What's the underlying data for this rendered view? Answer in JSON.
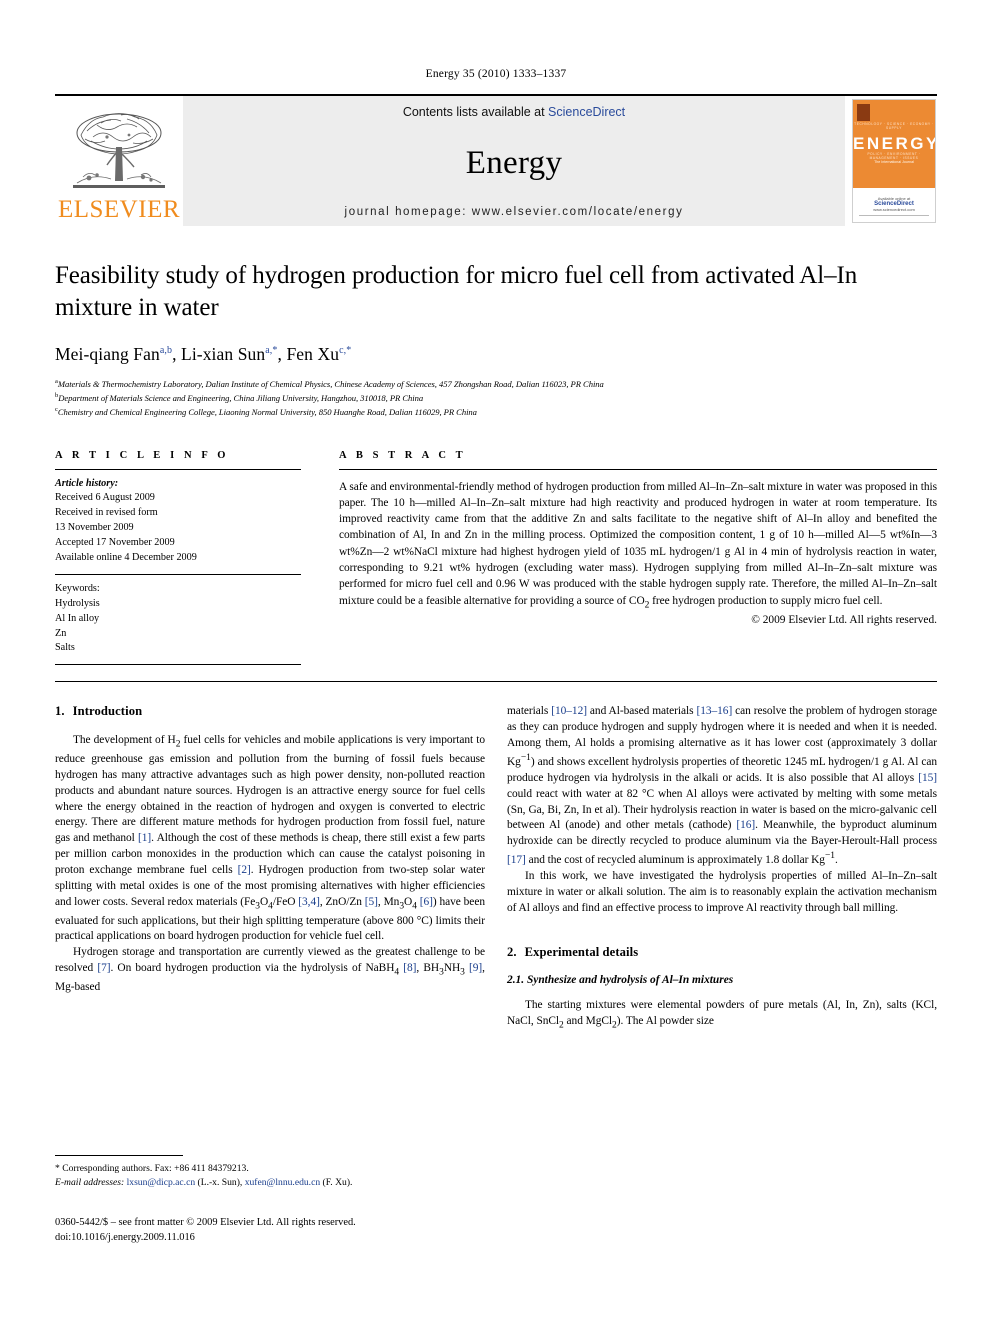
{
  "running_head": "Energy 35 (2010) 1333–1337",
  "masthead": {
    "publisher_name": "ELSEVIER",
    "contents_prefix": "Contents lists available at ",
    "contents_link": "ScienceDirect",
    "journal_name": "Energy",
    "homepage": "journal homepage: www.elsevier.com/locate/energy",
    "cover": {
      "title": "ENERGY",
      "subtitle": "The International Journal",
      "topics_row1": "TECHNOLOGY   ·   SCIENCE   ·   ECONOMY   ·   SUPPLY",
      "topics_row2": "POLICY   ·   ENVIRONMENT   ·   MANAGEMENT   ·   ISSUES",
      "available_at": "Available online at",
      "sciencedirect": "ScienceDirect",
      "url": "www.sciencedirect.com"
    }
  },
  "article": {
    "title": "Feasibility study of hydrogen production for micro fuel cell from activated Al–In mixture in water",
    "authors": [
      {
        "name": "Mei-qiang Fan",
        "marks": "a,b"
      },
      {
        "name": "Li-xian Sun",
        "marks": "a,*"
      },
      {
        "name": "Fen Xu",
        "marks": "c,*"
      }
    ],
    "affiliations": [
      {
        "mark": "a",
        "text": "Materials & Thermochemistry Laboratory, Dalian Institute of Chemical Physics, Chinese Academy of Sciences, 457 Zhongshan Road, Dalian 116023, PR China"
      },
      {
        "mark": "b",
        "text": "Department of Materials Science and Engineering, China Jiliang University, Hangzhou, 310018, PR China"
      },
      {
        "mark": "c",
        "text": "Chemistry and Chemical Engineering College, Liaoning Normal University, 850 Huanghe Road, Dalian 116029, PR China"
      }
    ]
  },
  "article_info": {
    "heading": "A R T I C L E  I N F O",
    "history_label": "Article history:",
    "history": [
      "Received 6 August 2009",
      "Received in revised form",
      "13 November 2009",
      "Accepted 17 November 2009",
      "Available online 4 December 2009"
    ],
    "keywords_label": "Keywords:",
    "keywords": [
      "Hydrolysis",
      "Al In alloy",
      "Zn",
      "Salts"
    ]
  },
  "abstract": {
    "heading": "A B S T R A C T",
    "text": "A safe and environmental-friendly method of hydrogen production from milled Al–In–Zn–salt mixture in water was proposed in this paper. The 10 h—milled Al–In–Zn–salt mixture had high reactivity and produced hydrogen in water at room temperature. Its improved reactivity came from that the additive Zn and salts facilitate to the negative shift of Al–In alloy and benefited the combination of Al, In and Zn in the milling process. Optimized the composition content, 1 g of 10 h—milled Al—5 wt%In—3 wt%Zn—2 wt%NaCl mixture had highest hydrogen yield of 1035 mL hydrogen/1 g Al in 4 min of hydrolysis reaction in water, corresponding to 9.21 wt% hydrogen (excluding water mass). Hydrogen supplying from milled Al–In–Zn–salt mixture was performed for micro fuel cell and 0.96 W was produced with the stable hydrogen supply rate. Therefore, the milled Al–In–Zn–salt mixture could be a feasible alternative for providing a source of CO2 free hydrogen production to supply micro fuel cell.",
    "copyright": "© 2009 Elsevier Ltd. All rights reserved."
  },
  "sections": {
    "intro": {
      "number": "1.",
      "title": "Introduction",
      "p1": "The development of H2 fuel cells for vehicles and mobile applications is very important to reduce greenhouse gas emission and pollution from the burning of fossil fuels because hydrogen has many attractive advantages such as high power density, non-polluted reaction products and abundant nature sources. Hydrogen is an attractive energy source for fuel cells where the energy obtained in the reaction of hydrogen and oxygen is converted to electric energy. There are different mature methods for hydrogen production from fossil fuel, nature gas and methanol [1]. Although the cost of these methods is cheap, there still exist a few parts per million carbon monoxides in the production which can cause the catalyst poisoning in proton exchange membrane fuel cells [2]. Hydrogen production from two-step solar water splitting with metal oxides is one of the most promising alternatives with higher efficiencies and lower costs. Several redox materials (Fe3O4/FeO [3,4], ZnO/Zn [5], Mn3O4 [6]) have been evaluated for such applications, but their high splitting temperature (above 800 °C) limits their practical applications on board hydrogen production for vehicle fuel cell.",
      "p2": "Hydrogen storage and transportation are currently viewed as the greatest challenge to be resolved [7]. On board hydrogen production via the hydrolysis of NaBH4 [8], BH3NH3 [9], Mg-based materials [10–12] and Al-based materials [13–16] can resolve the problem of hydrogen storage as they can produce hydrogen and supply hydrogen where it is needed and when it is needed. Among them, Al holds a promising alternative as it has lower cost (approximately 3 dollar Kg−1) and shows excellent hydrolysis properties of theoretic 1245 mL hydrogen/1 g Al. Al can produce hydrogen via hydrolysis in the alkali or acids. It is also possible that Al alloys [15] could react with water at 82 °C when Al alloys were activated by melting with some metals (Sn, Ga, Bi, Zn, In et al). Their hydrolysis reaction in water is based on the micro-galvanic cell between Al (anode) and other metals (cathode) [16]. Meanwhile, the byproduct aluminum hydroxide can be directly recycled to produce aluminum via the Bayer-Heroult-Hall process [17] and the cost of recycled aluminum is approximately 1.8 dollar Kg−1.",
      "p3": "In this work, we have investigated the hydrolysis properties of milled Al–In–Zn–salt mixture in water or alkali solution. The aim is to reasonably explain the activation mechanism of Al alloys and find an effective process to improve Al reactivity through ball milling."
    },
    "experimental": {
      "number": "2.",
      "title": "Experimental details",
      "sub_number": "2.1.",
      "sub_title": "Synthesize and hydrolysis of Al–In mixtures",
      "p1": "The starting mixtures were elemental powders of pure metals (Al, In, Zn), salts (KCl, NaCl, SnCl2 and MgCl2). The Al powder size"
    }
  },
  "footnotes": {
    "corresponding": "* Corresponding authors. Fax: +86 411 84379213.",
    "email_label": "E-mail addresses:",
    "email1": "lxsun@dicp.ac.cn",
    "email1_who": " (L.-x. Sun), ",
    "email2": "xufen@lnnu.edu.cn",
    "email2_who": " (F. Xu).",
    "issn_line": "0360-5442/$ – see front matter © 2009 Elsevier Ltd. All rights reserved.",
    "doi_line": "doi:10.1016/j.energy.2009.11.016"
  },
  "colors": {
    "elsevier_orange": "#F08C1E",
    "link_blue": "#2a4b9b",
    "reference_blue": "#1a3e8c",
    "masthead_grey": "#ededed"
  }
}
